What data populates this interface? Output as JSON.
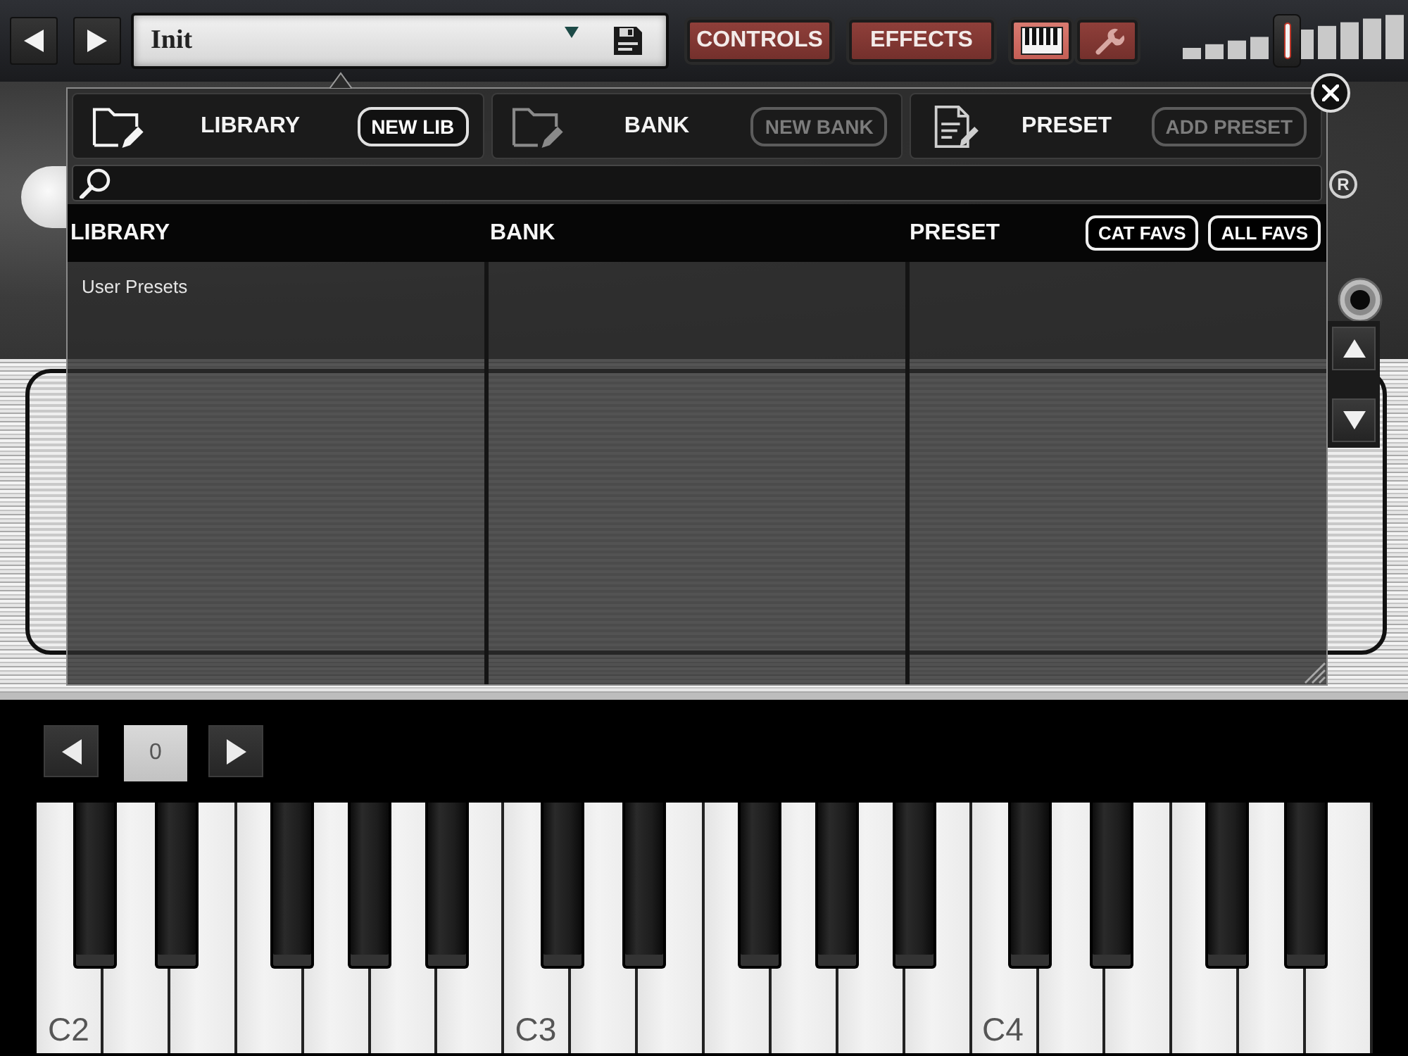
{
  "toolbar": {
    "preset_field": {
      "value": "Init"
    },
    "mode_buttons": [
      {
        "kind": "text",
        "label": "CONTROLS",
        "selected": false
      },
      {
        "kind": "text",
        "label": "EFFECTS",
        "selected": false
      },
      {
        "kind": "keyboard",
        "selected": true
      },
      {
        "kind": "wrench",
        "selected": false
      }
    ],
    "volume": {
      "level": 0.47
    }
  },
  "rack": {
    "registered_mark": "R"
  },
  "library_panel": {
    "sections": [
      {
        "kind": "library",
        "title": "LIBRARY",
        "button": {
          "label": "NEW LIB",
          "disabled": false
        }
      },
      {
        "kind": "bank",
        "title": "BANK",
        "button": {
          "label": "NEW BANK",
          "disabled": true
        }
      },
      {
        "kind": "preset",
        "title": "PRESET",
        "button": {
          "label": "ADD PRESET",
          "disabled": true
        }
      }
    ],
    "columns": [
      {
        "title": "LIBRARY",
        "items": [
          {
            "label": "User Presets",
            "selected": false
          }
        ]
      },
      {
        "title": "BANK"
      },
      {
        "title": "PRESET",
        "filters": [
          {
            "label": "CAT FAVS"
          },
          {
            "label": "ALL FAVS"
          }
        ]
      }
    ]
  },
  "keyboard": {
    "octave_shift": {
      "value": "0"
    },
    "octaves": [
      {
        "label": "C2",
        "partial": false
      },
      {
        "label": "C3",
        "partial": false
      },
      {
        "label": "C4",
        "partial": true
      }
    ]
  }
}
